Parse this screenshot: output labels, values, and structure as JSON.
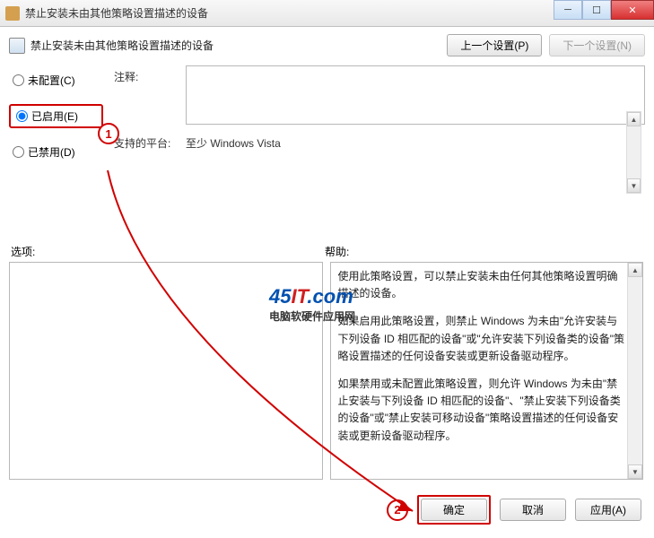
{
  "window": {
    "title": "禁止安装未由其他策略设置描述的设备"
  },
  "policy": {
    "header": "禁止安装未由其他策略设置描述的设备",
    "prev_button": "上一个设置(P)",
    "next_button": "下一个设置(N)"
  },
  "radio": {
    "not_configured": "未配置(C)",
    "enabled": "已启用(E)",
    "disabled": "已禁用(D)"
  },
  "fields": {
    "comment_label": "注释:",
    "platform_label": "支持的平台:",
    "platform_value": "至少 Windows Vista"
  },
  "labels": {
    "options": "选项:",
    "help": "帮助:"
  },
  "help": {
    "p1": "使用此策略设置，可以禁止安装未由任何其他策略设置明确描述的设备。",
    "p2": "如果启用此策略设置，则禁止 Windows 为未由\"允许安装与下列设备 ID 相匹配的设备\"或\"允许安装下列设备类的设备\"策略设置描述的任何设备安装或更新设备驱动程序。",
    "p3": "如果禁用或未配置此策略设置，则允许 Windows 为未由\"禁止安装与下列设备 ID 相匹配的设备\"、\"禁止安装下列设备类的设备\"或\"禁止安装可移动设备\"策略设置描述的任何设备安装或更新设备驱动程序。"
  },
  "buttons": {
    "ok": "确定",
    "cancel": "取消",
    "apply": "应用(A)"
  },
  "annotations": {
    "one": "1",
    "two": "2"
  },
  "watermark": {
    "brand_prefix": "45",
    "brand_mid": "IT",
    "brand_suffix": ".com",
    "subtitle": "电脑软硬件应用网"
  }
}
